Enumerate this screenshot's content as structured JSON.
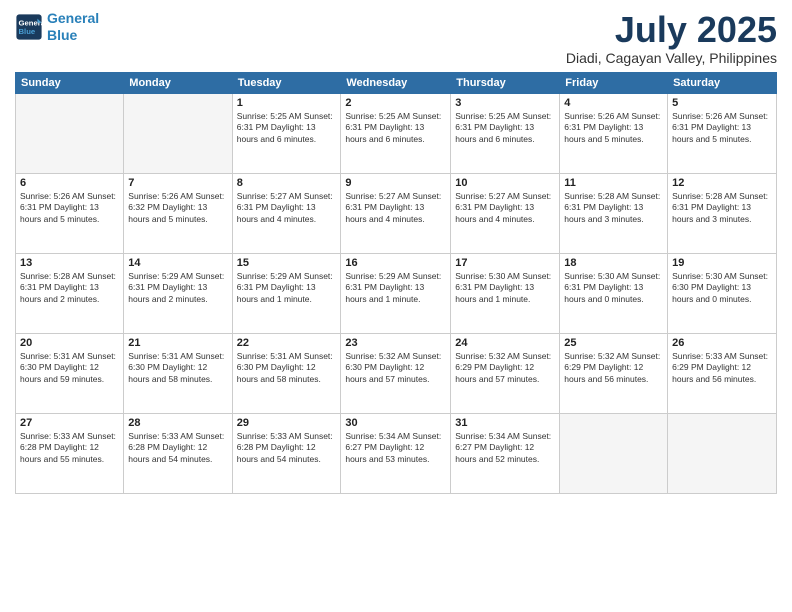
{
  "logo": {
    "line1": "General",
    "line2": "Blue"
  },
  "title": "July 2025",
  "location": "Diadi, Cagayan Valley, Philippines",
  "days_of_week": [
    "Sunday",
    "Monday",
    "Tuesday",
    "Wednesday",
    "Thursday",
    "Friday",
    "Saturday"
  ],
  "weeks": [
    [
      {
        "day": "",
        "info": ""
      },
      {
        "day": "",
        "info": ""
      },
      {
        "day": "1",
        "info": "Sunrise: 5:25 AM\nSunset: 6:31 PM\nDaylight: 13 hours\nand 6 minutes."
      },
      {
        "day": "2",
        "info": "Sunrise: 5:25 AM\nSunset: 6:31 PM\nDaylight: 13 hours\nand 6 minutes."
      },
      {
        "day": "3",
        "info": "Sunrise: 5:25 AM\nSunset: 6:31 PM\nDaylight: 13 hours\nand 6 minutes."
      },
      {
        "day": "4",
        "info": "Sunrise: 5:26 AM\nSunset: 6:31 PM\nDaylight: 13 hours\nand 5 minutes."
      },
      {
        "day": "5",
        "info": "Sunrise: 5:26 AM\nSunset: 6:31 PM\nDaylight: 13 hours\nand 5 minutes."
      }
    ],
    [
      {
        "day": "6",
        "info": "Sunrise: 5:26 AM\nSunset: 6:31 PM\nDaylight: 13 hours\nand 5 minutes."
      },
      {
        "day": "7",
        "info": "Sunrise: 5:26 AM\nSunset: 6:32 PM\nDaylight: 13 hours\nand 5 minutes."
      },
      {
        "day": "8",
        "info": "Sunrise: 5:27 AM\nSunset: 6:31 PM\nDaylight: 13 hours\nand 4 minutes."
      },
      {
        "day": "9",
        "info": "Sunrise: 5:27 AM\nSunset: 6:31 PM\nDaylight: 13 hours\nand 4 minutes."
      },
      {
        "day": "10",
        "info": "Sunrise: 5:27 AM\nSunset: 6:31 PM\nDaylight: 13 hours\nand 4 minutes."
      },
      {
        "day": "11",
        "info": "Sunrise: 5:28 AM\nSunset: 6:31 PM\nDaylight: 13 hours\nand 3 minutes."
      },
      {
        "day": "12",
        "info": "Sunrise: 5:28 AM\nSunset: 6:31 PM\nDaylight: 13 hours\nand 3 minutes."
      }
    ],
    [
      {
        "day": "13",
        "info": "Sunrise: 5:28 AM\nSunset: 6:31 PM\nDaylight: 13 hours\nand 2 minutes."
      },
      {
        "day": "14",
        "info": "Sunrise: 5:29 AM\nSunset: 6:31 PM\nDaylight: 13 hours\nand 2 minutes."
      },
      {
        "day": "15",
        "info": "Sunrise: 5:29 AM\nSunset: 6:31 PM\nDaylight: 13 hours\nand 1 minute."
      },
      {
        "day": "16",
        "info": "Sunrise: 5:29 AM\nSunset: 6:31 PM\nDaylight: 13 hours\nand 1 minute."
      },
      {
        "day": "17",
        "info": "Sunrise: 5:30 AM\nSunset: 6:31 PM\nDaylight: 13 hours\nand 1 minute."
      },
      {
        "day": "18",
        "info": "Sunrise: 5:30 AM\nSunset: 6:31 PM\nDaylight: 13 hours\nand 0 minutes."
      },
      {
        "day": "19",
        "info": "Sunrise: 5:30 AM\nSunset: 6:30 PM\nDaylight: 13 hours\nand 0 minutes."
      }
    ],
    [
      {
        "day": "20",
        "info": "Sunrise: 5:31 AM\nSunset: 6:30 PM\nDaylight: 12 hours\nand 59 minutes."
      },
      {
        "day": "21",
        "info": "Sunrise: 5:31 AM\nSunset: 6:30 PM\nDaylight: 12 hours\nand 58 minutes."
      },
      {
        "day": "22",
        "info": "Sunrise: 5:31 AM\nSunset: 6:30 PM\nDaylight: 12 hours\nand 58 minutes."
      },
      {
        "day": "23",
        "info": "Sunrise: 5:32 AM\nSunset: 6:30 PM\nDaylight: 12 hours\nand 57 minutes."
      },
      {
        "day": "24",
        "info": "Sunrise: 5:32 AM\nSunset: 6:29 PM\nDaylight: 12 hours\nand 57 minutes."
      },
      {
        "day": "25",
        "info": "Sunrise: 5:32 AM\nSunset: 6:29 PM\nDaylight: 12 hours\nand 56 minutes."
      },
      {
        "day": "26",
        "info": "Sunrise: 5:33 AM\nSunset: 6:29 PM\nDaylight: 12 hours\nand 56 minutes."
      }
    ],
    [
      {
        "day": "27",
        "info": "Sunrise: 5:33 AM\nSunset: 6:28 PM\nDaylight: 12 hours\nand 55 minutes."
      },
      {
        "day": "28",
        "info": "Sunrise: 5:33 AM\nSunset: 6:28 PM\nDaylight: 12 hours\nand 54 minutes."
      },
      {
        "day": "29",
        "info": "Sunrise: 5:33 AM\nSunset: 6:28 PM\nDaylight: 12 hours\nand 54 minutes."
      },
      {
        "day": "30",
        "info": "Sunrise: 5:34 AM\nSunset: 6:27 PM\nDaylight: 12 hours\nand 53 minutes."
      },
      {
        "day": "31",
        "info": "Sunrise: 5:34 AM\nSunset: 6:27 PM\nDaylight: 12 hours\nand 52 minutes."
      },
      {
        "day": "",
        "info": ""
      },
      {
        "day": "",
        "info": ""
      }
    ]
  ]
}
